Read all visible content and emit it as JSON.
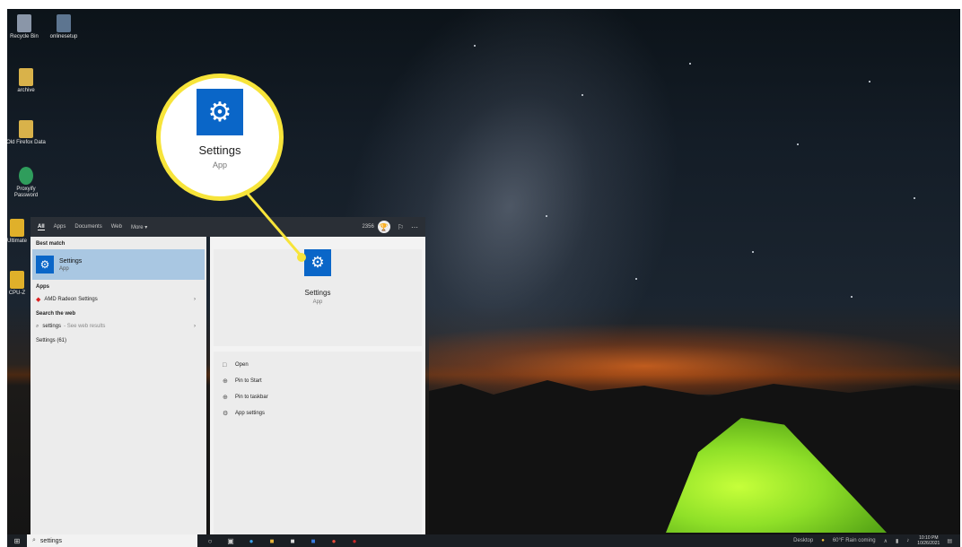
{
  "callout": {
    "title": "Settings",
    "subtitle": "App",
    "icon": "gear-icon"
  },
  "desktop_icons": [
    {
      "label": "Recycle Bin",
      "icon": "recycle-bin-icon"
    },
    {
      "label": "onlinesetup",
      "icon": "file-icon"
    },
    {
      "label": "archive",
      "icon": "folder-icon"
    },
    {
      "label": "Old Firefox Data",
      "icon": "folder-icon"
    },
    {
      "label": "Proxyify Password",
      "icon": "shield-icon"
    },
    {
      "label": "Ultimate",
      "icon": "app-icon"
    },
    {
      "label": "CPU-Z",
      "icon": "app-icon"
    }
  ],
  "search_panel": {
    "filters": [
      "All",
      "Apps",
      "Documents",
      "Web",
      "More ▾"
    ],
    "active_filter": "All",
    "points": "2356",
    "best_match_header": "Best match",
    "best_match": {
      "name": "Settings",
      "type": "App"
    },
    "apps_header": "Apps",
    "apps": [
      {
        "name": "AMD Radeon Settings"
      }
    ],
    "web_header": "Search the web",
    "web_result": {
      "query": "settings",
      "hint": "- See web results"
    },
    "web_extra": "Settings (61)",
    "preview": {
      "name": "Settings",
      "type": "App"
    },
    "actions": [
      {
        "label": "Open",
        "icon": "open-icon"
      },
      {
        "label": "Pin to Start",
        "icon": "pin-icon"
      },
      {
        "label": "Pin to taskbar",
        "icon": "pin-icon"
      },
      {
        "label": "App settings",
        "icon": "gear-icon"
      }
    ]
  },
  "taskbar": {
    "search_value": "settings",
    "weather": "60°F Rain coming",
    "desktop_label": "Desktop",
    "time": "10:10 PM",
    "date": "10/26/2021"
  },
  "colors": {
    "accent": "#0a66c8",
    "callout_border": "#f7e43a",
    "selection": "#a9c7e2"
  }
}
